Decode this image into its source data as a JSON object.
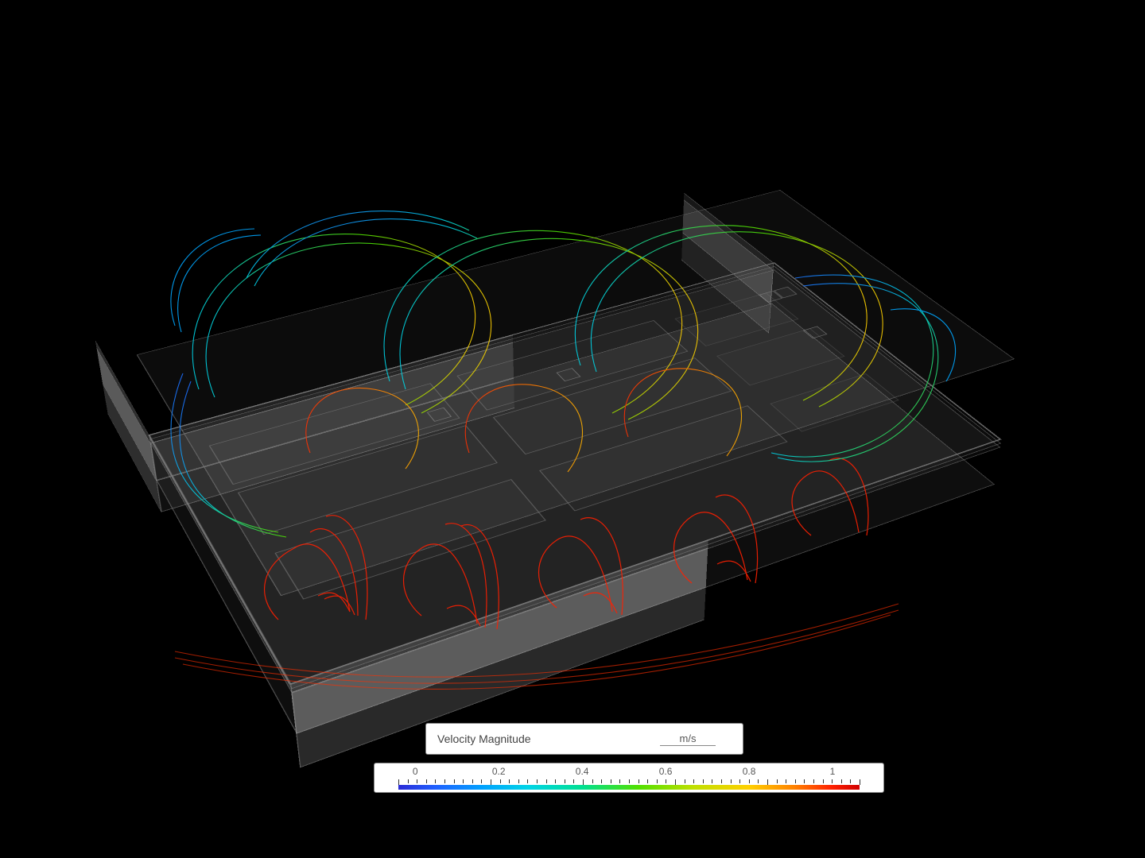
{
  "legend": {
    "quantity": "Velocity Magnitude",
    "unit": "m/s"
  },
  "colorbar": {
    "min": 0,
    "max": 1,
    "tick_labels": [
      "0",
      "0.2",
      "0.4",
      "0.6",
      "0.8",
      "1"
    ],
    "tick_positions_pct": [
      8,
      24.4,
      40.8,
      57.2,
      73.6,
      90
    ],
    "minor_ticks_per_interval": 9,
    "gradient_stops": [
      {
        "pct": 0,
        "color": "#2b2bd6"
      },
      {
        "pct": 8,
        "color": "#2060ff"
      },
      {
        "pct": 18,
        "color": "#00a0ff"
      },
      {
        "pct": 28,
        "color": "#00d4e8"
      },
      {
        "pct": 40,
        "color": "#00e090"
      },
      {
        "pct": 52,
        "color": "#50e000"
      },
      {
        "pct": 64,
        "color": "#c0e000"
      },
      {
        "pct": 76,
        "color": "#ffd000"
      },
      {
        "pct": 86,
        "color": "#ff8000"
      },
      {
        "pct": 94,
        "color": "#ff2000"
      },
      {
        "pct": 100,
        "color": "#d00000"
      }
    ]
  },
  "visualization": {
    "type": "3d_streamlines_isometric",
    "field": "Velocity Magnitude",
    "unit": "m/s",
    "value_range": [
      0,
      1
    ],
    "geometry": "rectangular room with raised-floor plenum containing parallel server-rack rows and support columns",
    "color_encoding": "rainbow (blue=low → red=high)",
    "notes": "dense red streamlines emerge from floor openings at front-row outlets; multicolored recirculation loops fill the upper volume"
  }
}
